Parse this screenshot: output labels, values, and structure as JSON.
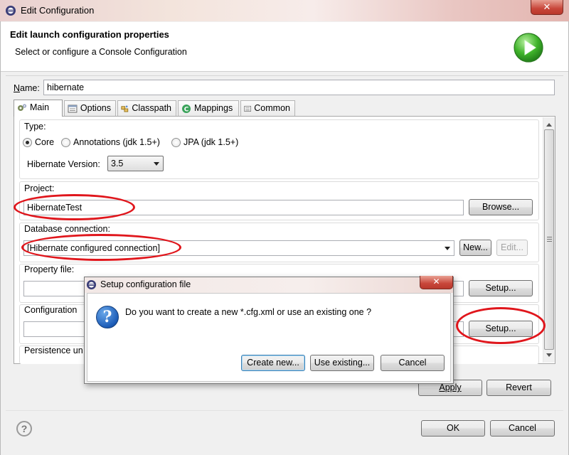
{
  "window": {
    "title": "Edit Configuration",
    "close_glyph": "✕"
  },
  "header": {
    "title": "Edit launch configuration properties",
    "subtitle": "Select or configure a Console Configuration",
    "icon": "run-icon"
  },
  "name_field": {
    "label_prefix": "N",
    "label_rest": "ame:",
    "value": "hibernate"
  },
  "tabs": [
    {
      "label": "Main",
      "icon": "main-tab-icon",
      "active": true
    },
    {
      "label": "Options",
      "icon": "options-tab-icon"
    },
    {
      "label": "Classpath",
      "icon": "classpath-tab-icon"
    },
    {
      "label": "Mappings",
      "icon": "mappings-tab-icon"
    },
    {
      "label": "Common",
      "icon": "common-tab-icon"
    }
  ],
  "type": {
    "label": "Type:",
    "options": [
      "Core",
      "Annotations (jdk 1.5+)",
      "JPA (jdk 1.5+)"
    ],
    "selected": "Core",
    "version_label": "Hibernate Version:",
    "version_value": "3.5"
  },
  "project": {
    "label": "Project:",
    "value": "HibernateTest",
    "browse": "Browse..."
  },
  "db_connection": {
    "label": "Database connection:",
    "value": "[Hibernate configured connection]",
    "new": "New...",
    "edit": "Edit..."
  },
  "property_file": {
    "label": "Property file:",
    "setup": "Setup..."
  },
  "configuration": {
    "label": "Configuration",
    "setup": "Setup..."
  },
  "persistence": {
    "label": "Persistence un"
  },
  "panel_buttons": {
    "apply": "Apply",
    "revert": "Revert"
  },
  "footer": {
    "ok": "OK",
    "cancel": "Cancel",
    "help_glyph": "?"
  },
  "dialog": {
    "title": "Setup configuration file",
    "message": "Do you want to create a new *.cfg.xml or use an existing one ?",
    "create_new": "Create new...",
    "use_existing": "Use existing...",
    "cancel": "Cancel",
    "close_glyph": "✕",
    "icon_glyph": "?"
  },
  "colors": {
    "annotation": "#e0161c",
    "accent": "#1d5db8"
  }
}
